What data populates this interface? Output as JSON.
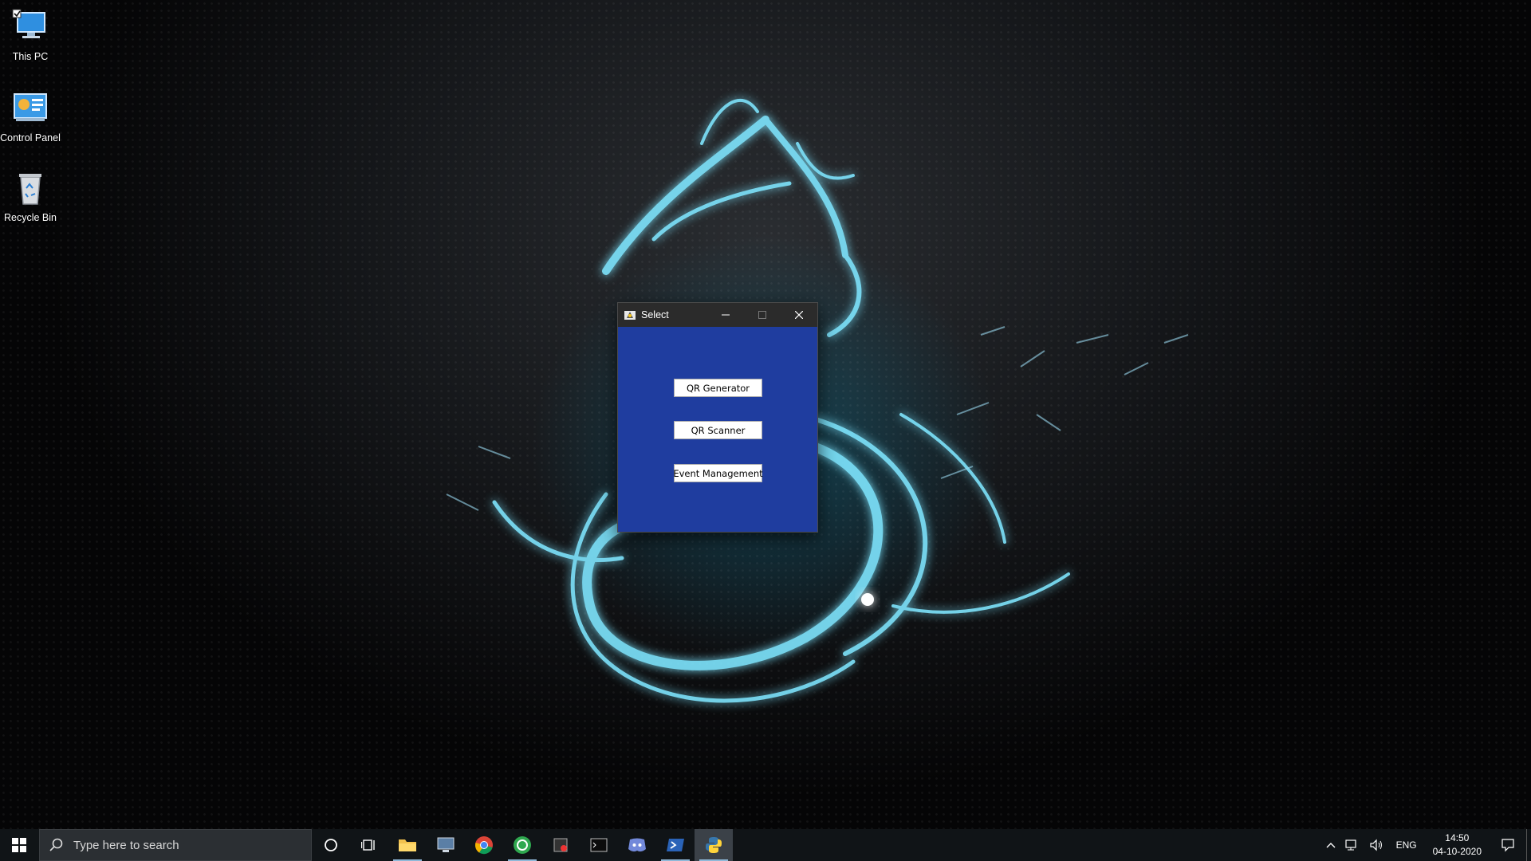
{
  "desktop": {
    "icons": [
      {
        "label": "This PC"
      },
      {
        "label": "Control Panel"
      },
      {
        "label": "Recycle Bin"
      }
    ]
  },
  "dialog": {
    "title": "Select",
    "buttons": [
      {
        "label": "QR Generator"
      },
      {
        "label": "QR Scanner"
      },
      {
        "label": "Event Management"
      }
    ],
    "background_color": "#1f3d9f"
  },
  "taskbar": {
    "search_placeholder": "Type here to search",
    "pinned_apps": [
      {
        "icon": "cortana-icon"
      },
      {
        "icon": "task-view-icon"
      },
      {
        "icon": "file-explorer-icon"
      },
      {
        "icon": "remote-desktop-icon"
      },
      {
        "icon": "chrome-icon"
      },
      {
        "icon": "green-app-icon"
      },
      {
        "icon": "media-app-icon"
      },
      {
        "icon": "terminal-icon"
      },
      {
        "icon": "discord-icon"
      },
      {
        "icon": "powershell-icon"
      },
      {
        "icon": "python-icon"
      }
    ],
    "tray": {
      "language": "ENG",
      "time": "14:50",
      "date": "04-10-2020"
    }
  }
}
